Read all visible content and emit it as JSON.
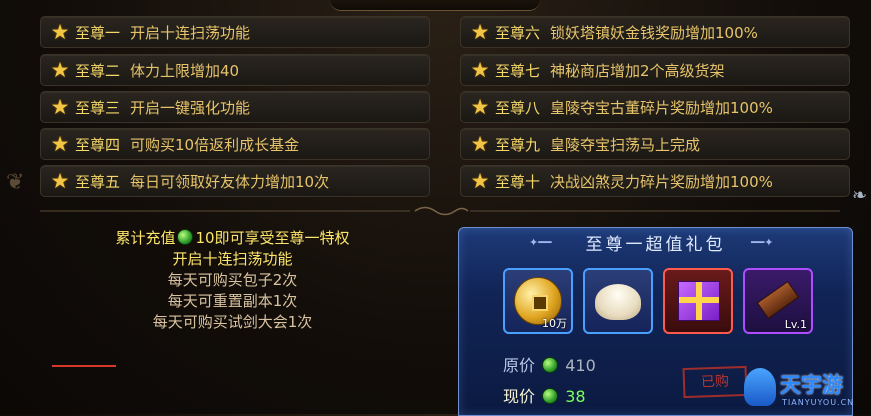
{
  "privileges": {
    "left": [
      {
        "rank": "至尊一",
        "desc": "开启十连扫荡功能"
      },
      {
        "rank": "至尊二",
        "desc": "体力上限增加40"
      },
      {
        "rank": "至尊三",
        "desc": "开启一键强化功能"
      },
      {
        "rank": "至尊四",
        "desc": "可购买10倍返利成长基金"
      },
      {
        "rank": "至尊五",
        "desc": "每日可领取好友体力增加10次"
      }
    ],
    "right": [
      {
        "rank": "至尊六",
        "desc": "锁妖塔镇妖金钱奖励增加100%"
      },
      {
        "rank": "至尊七",
        "desc": "神秘商店增加2个高级货架"
      },
      {
        "rank": "至尊八",
        "desc": "皇陵夺宝古董碎片奖励增加100%"
      },
      {
        "rank": "至尊九",
        "desc": "皇陵夺宝扫荡马上完成"
      },
      {
        "rank": "至尊十",
        "desc": "决战凶煞灵力碎片奖励增加100%"
      }
    ]
  },
  "vip_info": {
    "line1_prefix": "累计充值",
    "line1_suffix": "10即可享受至尊一特权",
    "line2": "开启十连扫荡功能",
    "line3": "每天可购买包子2次",
    "line4": "每天可重置副本1次",
    "line5": "每天可购买试剑大会1次"
  },
  "gift_panel": {
    "title": "至尊一超值礼包",
    "items": [
      {
        "icon": "gold-coin-icon",
        "badge": "10万"
      },
      {
        "icon": "steamed-bun-icon",
        "badge": ""
      },
      {
        "icon": "gift-box-icon",
        "badge": ""
      },
      {
        "icon": "wooden-plank-icon",
        "badge": "Lv.1"
      }
    ],
    "original_price_label": "原价",
    "original_price": "410",
    "current_price_label": "现价",
    "current_price": "38",
    "stamp": "已购"
  },
  "watermark": {
    "name": "天宇游",
    "sub": "TIANYUYOU.CN"
  },
  "colors": {
    "gold_text": "#e7c46a",
    "gem_green": "#2e9c2a",
    "panel_blue": "#112456"
  }
}
